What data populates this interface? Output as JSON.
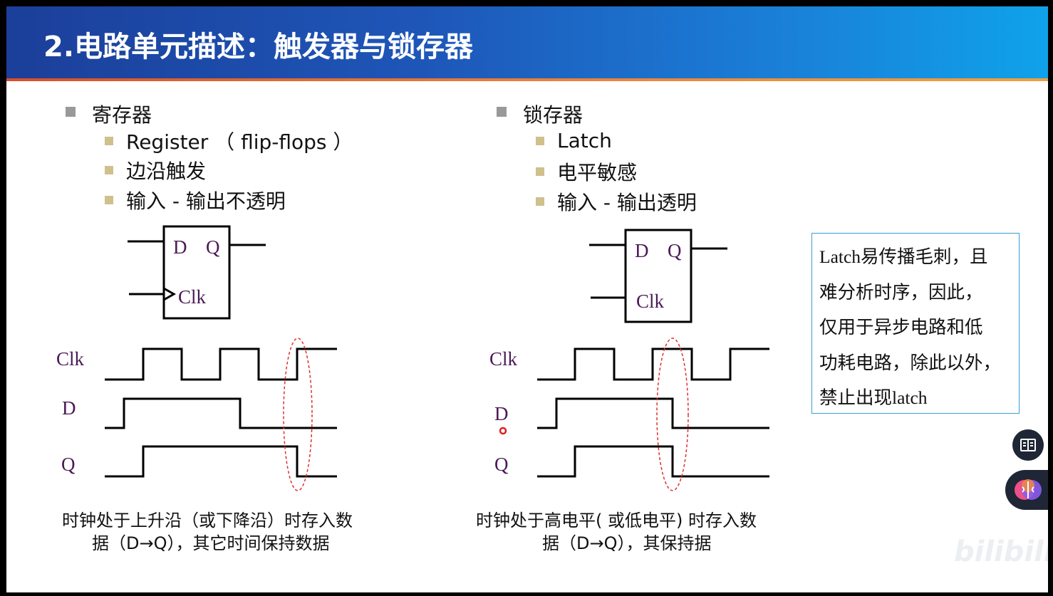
{
  "slide_title": "2.电路单元描述：触发器与锁存器",
  "left": {
    "heading": "寄存器",
    "items": [
      "Register （ flip-flops ）",
      "边沿触发",
      "输入 - 输出不透明"
    ],
    "symbol": {
      "d": "D",
      "q": "Q",
      "clk": "Clk"
    },
    "waveform_labels": {
      "clk": "Clk",
      "d": "D",
      "q": "Q"
    },
    "caption_line1": "时钟处于上升沿（或下降沿）时存入数",
    "caption_line2": "据（D→Q），其它时间保持数据"
  },
  "right": {
    "heading": "锁存器",
    "items": [
      "Latch",
      "电平敏感",
      "输入 - 输出透明"
    ],
    "symbol": {
      "d": "D",
      "q": "Q",
      "clk": "Clk"
    },
    "waveform_labels": {
      "clk": "Clk",
      "d": "D",
      "q": "Q"
    },
    "caption_line1": "时钟处于高电平( 或低电平) 时存入数",
    "caption_line2": "据（D→Q），其保持据"
  },
  "note": {
    "lines": [
      "Latch易传播毛刺，且",
      "难分析时序，因此，",
      "仅用于异步电路和低",
      "功耗电路，除此以外，",
      "禁止出现latch"
    ]
  },
  "watermark": "bilibili",
  "icons": {
    "book_button": "book-icon",
    "brain_button": "brain-icon"
  },
  "colors": {
    "header_start": "#1b3f9a",
    "header_end": "#0fa2ea",
    "accent": "#e8803a",
    "note_border": "#3b9ed4",
    "label_purple": "#4a1a55",
    "highlight_ellipse": "#e03030"
  }
}
